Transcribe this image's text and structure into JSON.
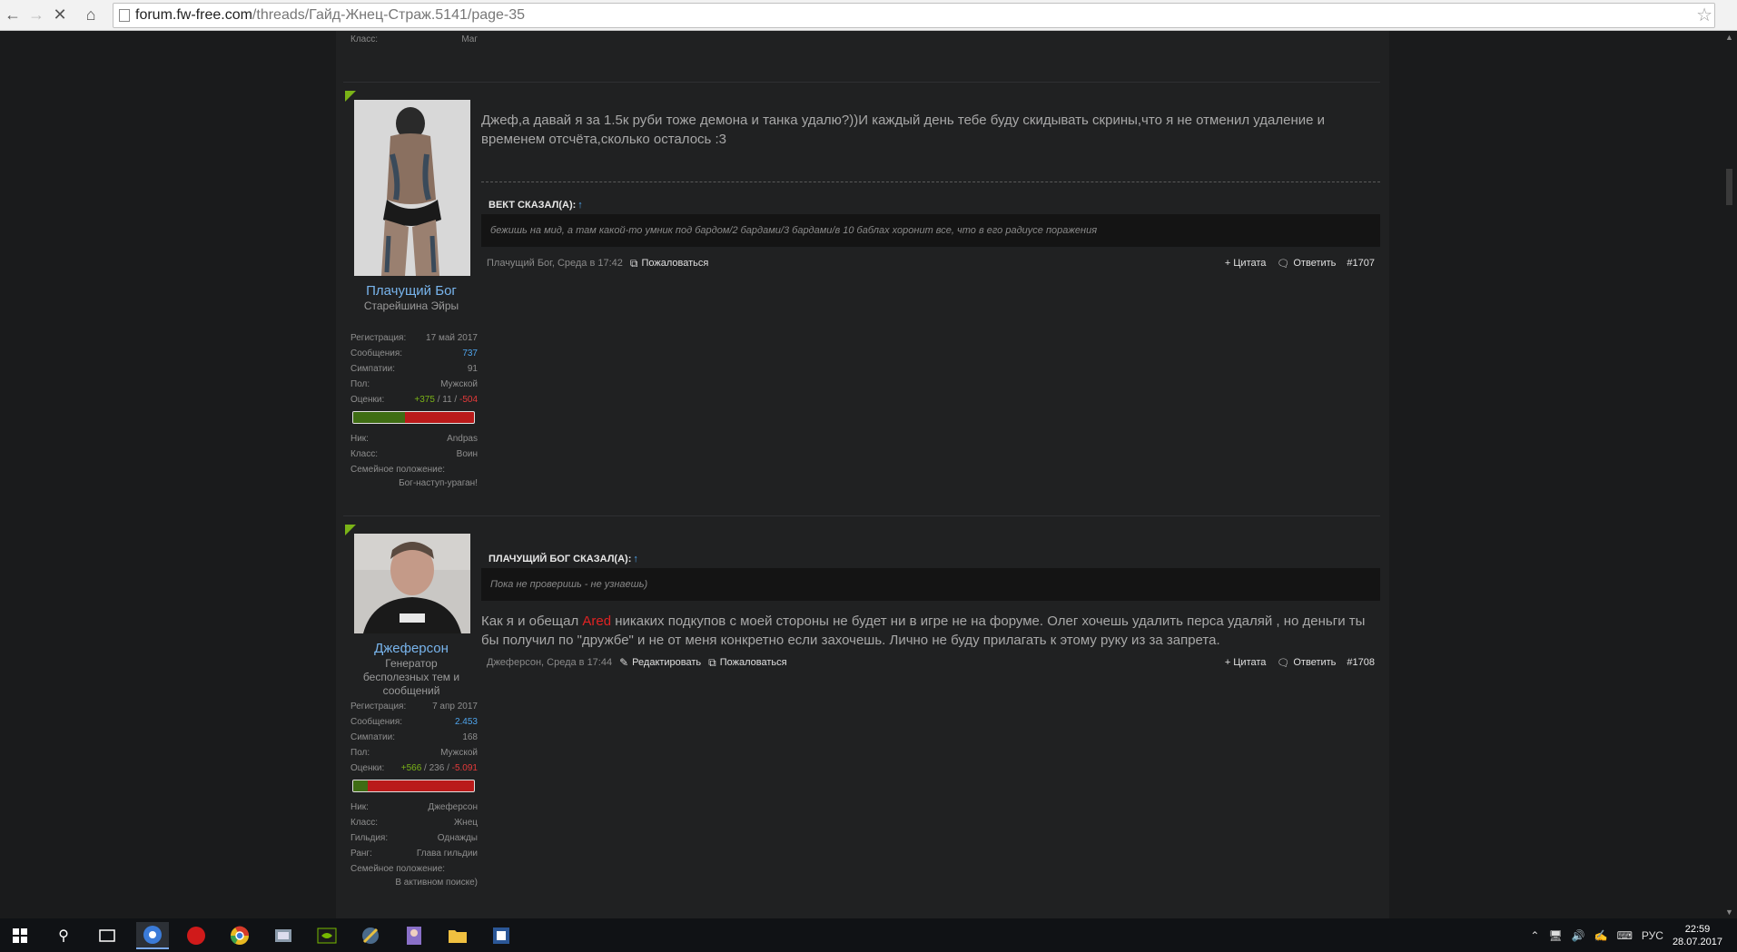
{
  "browser": {
    "url_host": "forum.fw-free.com",
    "url_path": "/threads/Гайд-Жнец-Страж.5141/page-35"
  },
  "previous_post_tail": {
    "class_label": "Класс:",
    "class_value": "Маг"
  },
  "posts": [
    {
      "username": "Плачущий Бог",
      "user_title": "Старейшина Эйры",
      "stats": {
        "reg_label": "Регистрация:",
        "reg_value": "17 май 2017",
        "msgs_label": "Сообщения:",
        "msgs_value": "737",
        "likes_label": "Симпатии:",
        "likes_value": "91",
        "gender_label": "Пол:",
        "gender_value": "Мужской",
        "ratings_label": "Оценки:",
        "ratings_pos": "+375",
        "ratings_mid": " / 11 / ",
        "ratings_neg": "-504",
        "ratings_bar_positive_fraction": 0.43,
        "nick_label": "Ник:",
        "nick_value": "Andpas",
        "class_label": "Класс:",
        "class_value": "Воин",
        "family_label": "Семейное положение:",
        "family_value": "Бог-наступ-ураган!"
      },
      "message": "Джеф,а давай я за 1.5к руби тоже демона и танка удалю?))И каждый день тебе буду скидывать скрины,что я не отменил удаление и временем отсчёта,сколько осталось :3",
      "quote_author": "Вект сказал(а):",
      "quote_text": "бежишь на мид, а там какой-то умник под бардом/2 бардами/3 бардами/в 10 баблах хоронит все, что в его радиусе поражения",
      "meta_author": "Плачущий Бог, Среда в 17:42",
      "report_label": "Пожаловаться",
      "quote_label": "+ Цитата",
      "reply_label": "Ответить",
      "post_number": "#1707"
    },
    {
      "username": "Джеферсон",
      "user_title": "Генератор бесполезных тем и сообщений",
      "stats": {
        "reg_label": "Регистрация:",
        "reg_value": "7 апр 2017",
        "msgs_label": "Сообщения:",
        "msgs_value": "2.453",
        "likes_label": "Симпатии:",
        "likes_value": "168",
        "gender_label": "Пол:",
        "gender_value": "Мужской",
        "ratings_label": "Оценки:",
        "ratings_pos": "+566",
        "ratings_mid": " / 236 / ",
        "ratings_neg": "-5.091",
        "ratings_bar_positive_fraction": 0.12,
        "nick_label": "Ник:",
        "nick_value": "Джеферсон",
        "class_label": "Класс:",
        "class_value": "Жнец",
        "guild_label": "Гильдия:",
        "guild_value": "Однажды",
        "rank_label": "Ранг:",
        "rank_value": "Глава гильдии",
        "family_label": "Семейное положение:",
        "family_value": "В активном поиске)"
      },
      "quote_author": "Плачущий Бог сказал(а):",
      "quote_text": "Пока не проверишь - не узнаешь)",
      "message_before": "Как я и обещал ",
      "message_highlight": "Ared",
      "message_after": " никаких подкупов с моей стороны не будет ни в игре не на форуме. Олег хочешь удалить перса удаляй , но деньги ты бы получил по \"дружбе\" и не от меня конкретно если захочешь. Лично не буду прилагать к этому руку из за запрета.",
      "meta_author": "Джеферсон, Среда в 17:44",
      "edit_label": "Редактировать",
      "report_label": "Пожаловаться",
      "quote_label": "+ Цитата",
      "reply_label": "Ответить",
      "post_number": "#1708"
    }
  ],
  "taskbar": {
    "language": "РУС",
    "time": "22:59",
    "date": "28.07.2017"
  },
  "colors": {
    "accent_green": "#7ab317",
    "link_blue": "#78b4ec",
    "negative_red": "#e53a3a"
  }
}
